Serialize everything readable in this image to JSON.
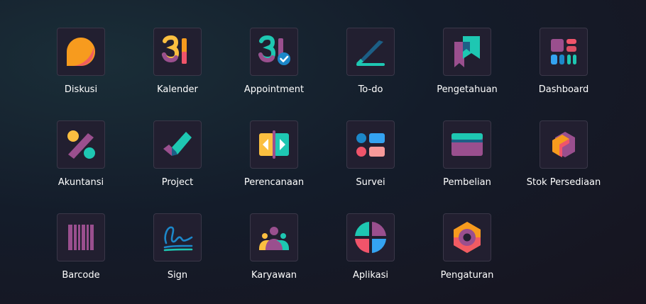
{
  "apps": [
    {
      "label": "Diskusi",
      "icon": "chat-bubble-icon"
    },
    {
      "label": "Kalender",
      "icon": "calendar-31-icon",
      "number": "31"
    },
    {
      "label": "Appointment",
      "icon": "calendar-check-icon",
      "number": "31"
    },
    {
      "label": "To-do",
      "icon": "pen-icon"
    },
    {
      "label": "Pengetahuan",
      "icon": "bookmark-icon"
    },
    {
      "label": "Dashboard",
      "icon": "dashboard-grid-icon"
    },
    {
      "label": "Akuntansi",
      "icon": "percent-icon"
    },
    {
      "label": "Project",
      "icon": "checkmark-icon"
    },
    {
      "label": "Perencanaan",
      "icon": "planning-arrows-icon"
    },
    {
      "label": "Survei",
      "icon": "survey-icon"
    },
    {
      "label": "Pembelian",
      "icon": "credit-card-icon"
    },
    {
      "label": "Stok Persediaan",
      "icon": "inventory-box-icon"
    },
    {
      "label": "Barcode",
      "icon": "barcode-icon"
    },
    {
      "label": "Sign",
      "icon": "signature-icon"
    },
    {
      "label": "Karyawan",
      "icon": "employees-icon"
    },
    {
      "label": "Aplikasi",
      "icon": "apps-circle-icon"
    },
    {
      "label": "Pengaturan",
      "icon": "gear-hexagon-icon"
    }
  ],
  "colors": {
    "tile_bg": "#221f30",
    "tile_border": "#3a3748",
    "label": "#ffffff",
    "orange": "#f79b1e",
    "purple": "#9a4f8e",
    "teal": "#1ec7b2",
    "blue": "#34a3f1",
    "red": "#f0546a",
    "yellow": "#fbbf40"
  }
}
